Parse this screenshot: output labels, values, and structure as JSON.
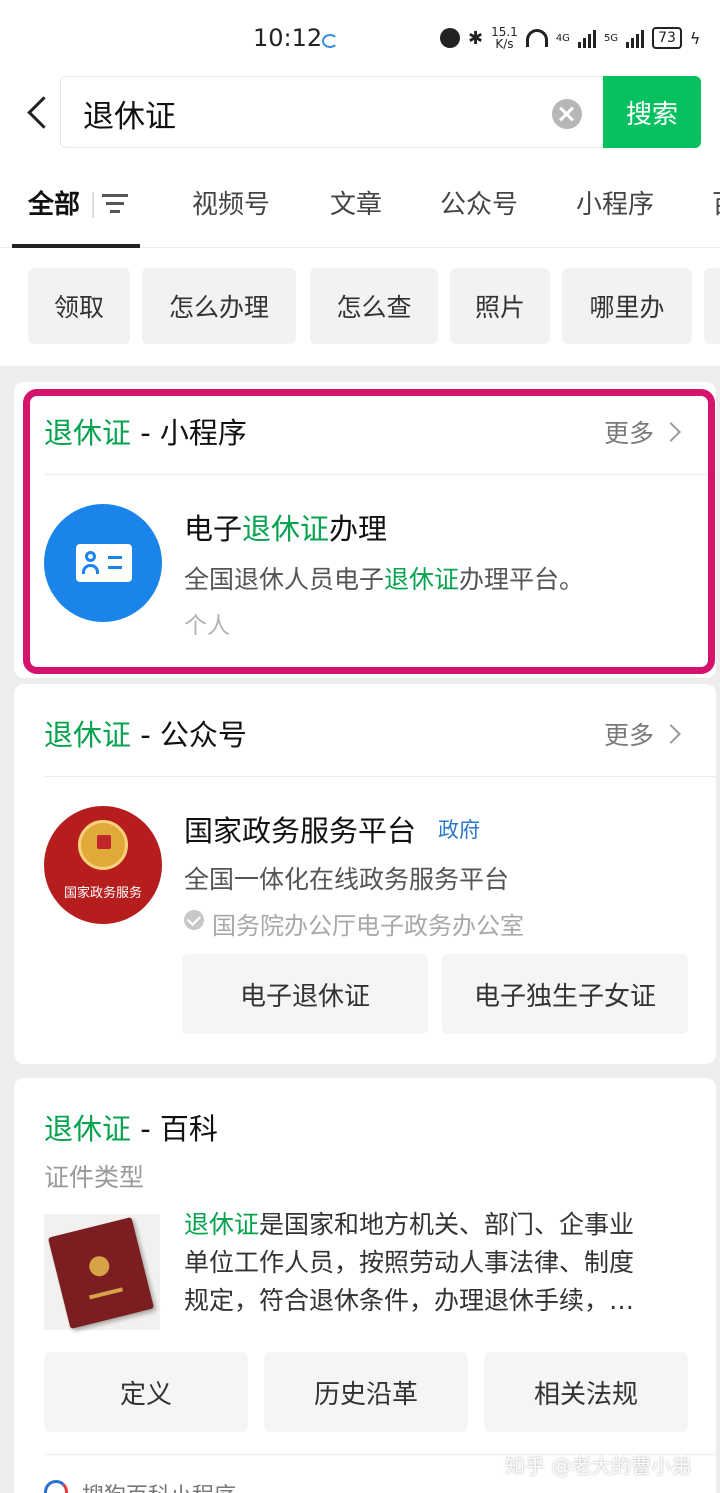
{
  "status_bar": {
    "time": "10:12",
    "net_speed_top": "15.1",
    "net_speed_bottom": "K/s",
    "net_4g": "4G",
    "net_5g": "5G",
    "battery": "73"
  },
  "search": {
    "query": "退休证",
    "button_label": "搜索"
  },
  "tabs": [
    {
      "label": "全部",
      "active": true
    },
    {
      "label": "视频号"
    },
    {
      "label": "文章"
    },
    {
      "label": "公众号"
    },
    {
      "label": "小程序"
    },
    {
      "label": "百"
    }
  ],
  "chips": [
    "领取",
    "怎么办理",
    "怎么查",
    "照片",
    "哪里办"
  ],
  "mini_program_section": {
    "keyword": "退休证",
    "suffix": " - 小程序",
    "more": "更多",
    "item": {
      "title_prefix": "电子",
      "title_keyword": "退休证",
      "title_suffix": "办理",
      "desc_prefix": "全国退休人员电子",
      "desc_keyword": "退休证",
      "desc_suffix": "办理平台。",
      "meta": "个人"
    }
  },
  "official_account_section": {
    "keyword": "退休证",
    "suffix": " - 公众号",
    "more": "更多",
    "item": {
      "title": "国家政务服务平台",
      "tag": "政府",
      "desc": "全国一体化在线政务服务平台",
      "verified_by": "国务院办公厅电子政务办公室",
      "badge_text": "国家政务服务"
    },
    "buttons": [
      "电子退休证",
      "电子独生子女证"
    ]
  },
  "wiki_section": {
    "keyword": "退休证",
    "suffix": " - 百科",
    "category": "证件类型",
    "text_keyword": "退休证",
    "text_line1_rest": "是国家和地方机关、部门、企事业",
    "text_line2": "单位工作人员，按照劳动人事法律、制度",
    "text_line3": "规定，符合退休条件，办理退休手续，…",
    "buttons": [
      "定义",
      "历史沿革",
      "相关法规"
    ],
    "footer_source": "搜狗百科小程序"
  },
  "watermark": "知乎 @老大的曹小弟",
  "colors": {
    "accent_green": "#07c160",
    "highlight_green": "#07a34f",
    "highlight_frame": "#d3136c",
    "gov_blue": "#2d79c7"
  }
}
